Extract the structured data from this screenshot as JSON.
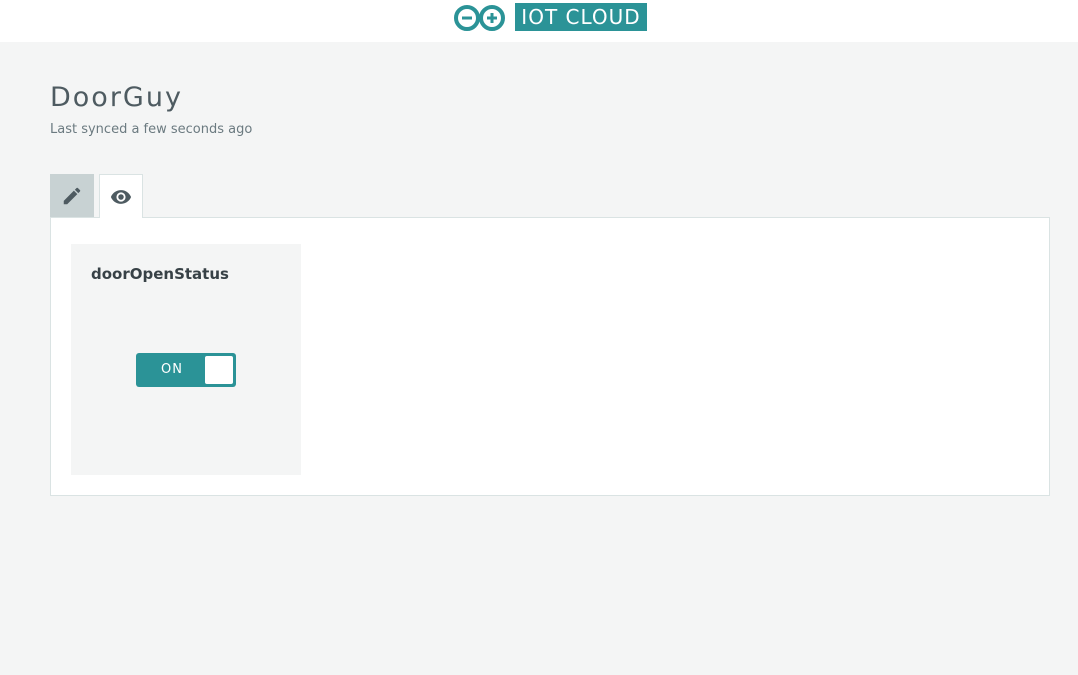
{
  "header": {
    "logo_text": "IOT CLOUD",
    "brand_color": "#2b9397",
    "logo_icon": "arduino-infinity-icon"
  },
  "thing": {
    "name": "DoorGuy",
    "sync_status": "Last synced a few seconds ago"
  },
  "tabs": [
    {
      "icon": "pencil-icon",
      "name": "edit"
    },
    {
      "icon": "eye-icon",
      "name": "dashboard"
    }
  ],
  "widgets": [
    {
      "title": "doorOpenStatus",
      "type": "switch",
      "state_label": "ON",
      "state": true
    }
  ]
}
